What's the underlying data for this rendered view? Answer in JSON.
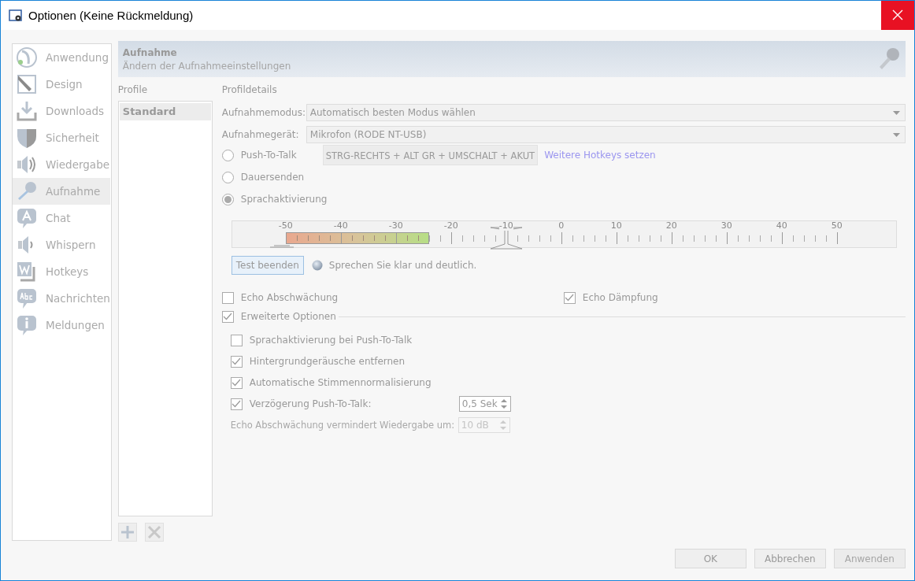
{
  "window": {
    "title": "Optionen (Keine Rückmeldung)"
  },
  "sidebar": {
    "items": [
      {
        "label": "Anwendung",
        "kind": "app",
        "selected": false
      },
      {
        "label": "Design",
        "kind": "design",
        "selected": false
      },
      {
        "label": "Downloads",
        "kind": "download",
        "selected": false
      },
      {
        "label": "Sicherheit",
        "kind": "shield",
        "selected": false
      },
      {
        "label": "Wiedergabe",
        "kind": "speaker",
        "selected": false
      },
      {
        "label": "Aufnahme",
        "kind": "microphone",
        "selected": true
      },
      {
        "label": "Chat",
        "kind": "chat",
        "selected": false
      },
      {
        "label": "Whispern",
        "kind": "whisper",
        "selected": false
      },
      {
        "label": "Hotkeys",
        "kind": "hotkeys",
        "selected": false
      },
      {
        "label": "Nachrichten",
        "kind": "messages",
        "selected": false
      },
      {
        "label": "Meldungen",
        "kind": "info",
        "selected": false
      }
    ]
  },
  "header": {
    "title": "Aufnahme",
    "subtitle": "Ändern der Aufnahmeeinstellungen"
  },
  "profiles": {
    "label": "Profile",
    "items": [
      {
        "label": "Standard",
        "selected": true
      }
    ]
  },
  "details": {
    "label": "Profildetails",
    "fields": [
      {
        "label": "Aufnahmemodus:",
        "value": "Automatisch besten Modus wählen"
      },
      {
        "label": "Aufnahmegerät:",
        "value": "Mikrofon (RODE NT-USB)"
      }
    ],
    "modes": [
      {
        "label": "Push-To-Talk",
        "selected": false,
        "hotkey": "STRG-RECHTS + ALT GR + UMSCHALT + AKUT",
        "link": "Weitere Hotkeys setzen"
      },
      {
        "label": "Dauersenden",
        "selected": false
      },
      {
        "label": "Sprachaktivierung",
        "selected": true
      }
    ],
    "meter": {
      "scale": [
        "-50",
        "-40",
        "-30",
        "-20",
        "-10",
        "0",
        "10",
        "20",
        "30",
        "40",
        "50"
      ],
      "level": 0.26,
      "threshold": {
        "level": 0.4
      }
    },
    "test": {
      "button": "Test beenden",
      "status": "Sprechen Sie klar und deutlich."
    },
    "echo": [
      {
        "label": "Echo Abschwächung",
        "checked": false
      },
      {
        "label": "Echo Dämpfung",
        "checked": true
      }
    ],
    "advanced": {
      "label": "Erweiterte Optionen",
      "checked": true,
      "options": [
        {
          "label": "Sprachaktivierung bei Push-To-Talk",
          "checked": false
        },
        {
          "label": "Hintergrundgeräusche entfernen",
          "checked": true
        },
        {
          "label": "Automatische Stimmennormalisierung",
          "checked": true
        },
        {
          "label": "Verzögerung Push-To-Talk:",
          "checked": true,
          "value": "0,5 Sek"
        }
      ],
      "reduction": {
        "label": "Echo Abschwächung vermindert Wiedergabe um:",
        "value": "10 dB",
        "disabled": true
      }
    }
  },
  "buttons": [
    {
      "label": "OK",
      "disabled": false
    },
    {
      "label": "Abbrechen",
      "disabled": false
    },
    {
      "label": "Anwenden",
      "disabled": true
    }
  ]
}
